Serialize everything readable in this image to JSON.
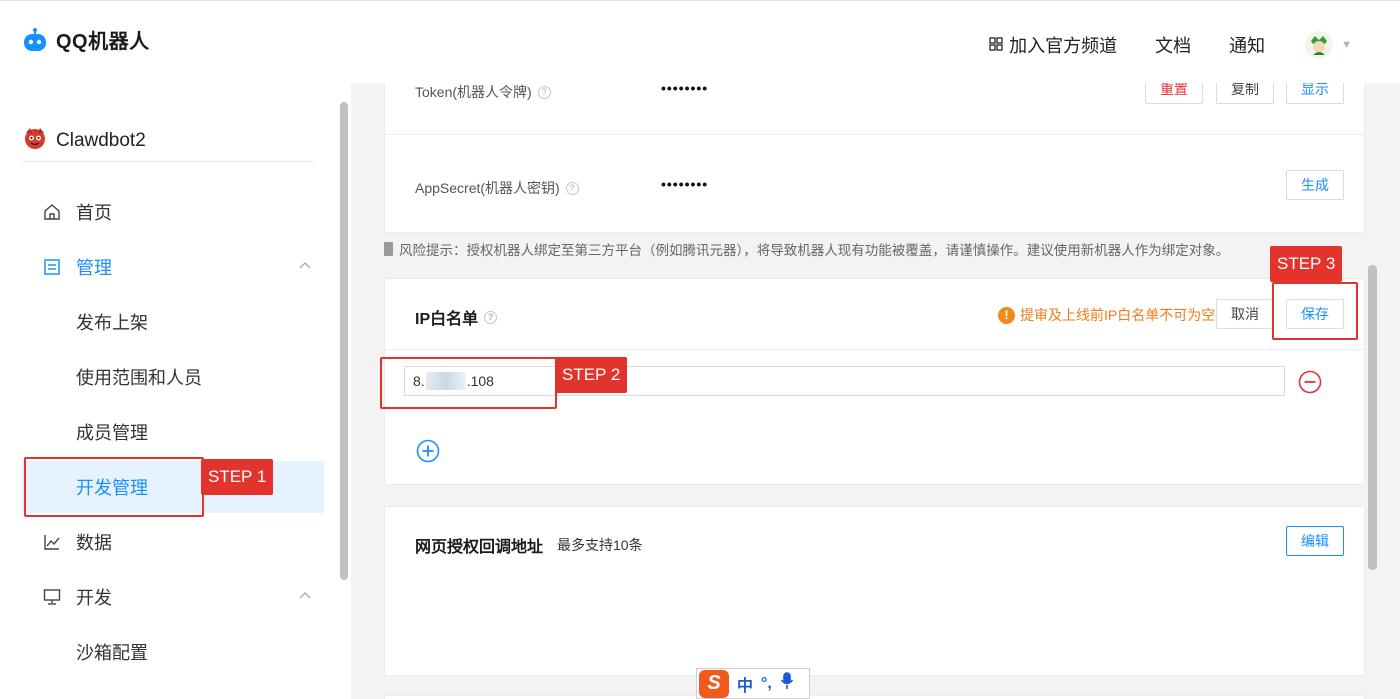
{
  "app": {
    "name": "QQ机器人"
  },
  "topnav": {
    "channel": "加入官方频道",
    "docs": "文档",
    "notify": "通知"
  },
  "bot": {
    "name": "Clawdbot2"
  },
  "sidebar": {
    "home": "首页",
    "manage": "管理",
    "publish": "发布上架",
    "scope": "使用范围和人员",
    "members": "成员管理",
    "devmanage": "开发管理",
    "data": "数据",
    "dev": "开发",
    "sandbox": "沙箱配置"
  },
  "credentials": {
    "token_label": "Token(机器人令牌)",
    "token_value": "••••••••",
    "reset": "重置",
    "copy": "复制",
    "show": "显示",
    "secret_label": "AppSecret(机器人密钥)",
    "secret_value": "••••••••",
    "generate": "生成"
  },
  "risk_notice": "风险提示：授权机器人绑定至第三方平台（例如腾讯元器），将导致机器人现有功能被覆盖，请谨慎操作。建议使用新机器人作为绑定对象。",
  "whitelist": {
    "title": "IP白名单",
    "warning": "提审及上线前IP白名单不可为空",
    "cancel": "取消",
    "save": "保存",
    "ip_prefix": "8.",
    "ip_suffix": ".108"
  },
  "callback": {
    "title": "网页授权回调地址",
    "hint": "最多支持10条",
    "edit": "编辑"
  },
  "annotations": {
    "step1": "STEP 1",
    "step2": "STEP 2",
    "step3": "STEP 3"
  },
  "ime": {
    "mode": "中",
    "punct": "°,"
  },
  "colors": {
    "accent": "#1890ff",
    "annotation": "#e2342c",
    "warning": "#f07c1a"
  }
}
